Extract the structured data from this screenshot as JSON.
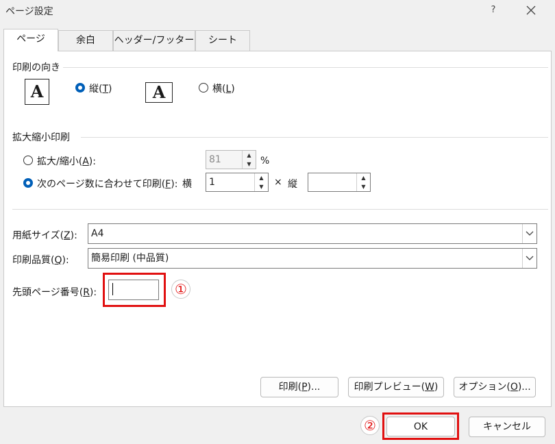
{
  "window": {
    "title": "ページ設定",
    "help_label": "?"
  },
  "tabs": [
    {
      "label": "ページ",
      "active": true
    },
    {
      "label": "余白"
    },
    {
      "label": "ヘッダー/フッター"
    },
    {
      "label": "シート"
    }
  ],
  "orientation": {
    "section_label": "印刷の向き",
    "portrait": {
      "label": "縦(",
      "key": "T",
      "suffix": ")",
      "selected": true
    },
    "landscape": {
      "label": "横(",
      "key": "L",
      "suffix": ")",
      "selected": false
    },
    "icon_glyph": "A"
  },
  "scaling": {
    "section_label": "拡大縮小印刷",
    "adjust": {
      "label": "拡大/縮小(",
      "key": "A",
      "suffix": "):",
      "value": "81",
      "unit": "%",
      "selected": false
    },
    "fit": {
      "label": "次のページ数に合わせて印刷(",
      "key": "F",
      "suffix": "):",
      "wide_label": "横",
      "wide_value": "1",
      "times": "×",
      "tall_label": "縦",
      "tall_value": "",
      "selected": true
    }
  },
  "paper_size": {
    "label": "用紙サイズ(",
    "key": "Z",
    "suffix": "):",
    "value": "A4"
  },
  "print_quality": {
    "label": "印刷品質(",
    "key": "Q",
    "suffix": "):",
    "value": "簡易印刷 (中品質)"
  },
  "first_page": {
    "label": "先頭ページ番号(",
    "key": "R",
    "suffix": "):",
    "value": ""
  },
  "buttons": {
    "print": {
      "label": "印刷(",
      "key": "P",
      "suffix": ")..."
    },
    "preview": {
      "label": "印刷プレビュー(",
      "key": "W",
      "suffix": ")"
    },
    "options": {
      "label": "オプション(",
      "key": "O",
      "suffix": ")..."
    },
    "ok": "OK",
    "cancel": "キャンセル"
  },
  "annotations": {
    "marker1": "①",
    "marker2": "②",
    "color": "#e11010"
  },
  "colors": {
    "accent": "#005fb8",
    "highlight_red": "#e11010"
  }
}
